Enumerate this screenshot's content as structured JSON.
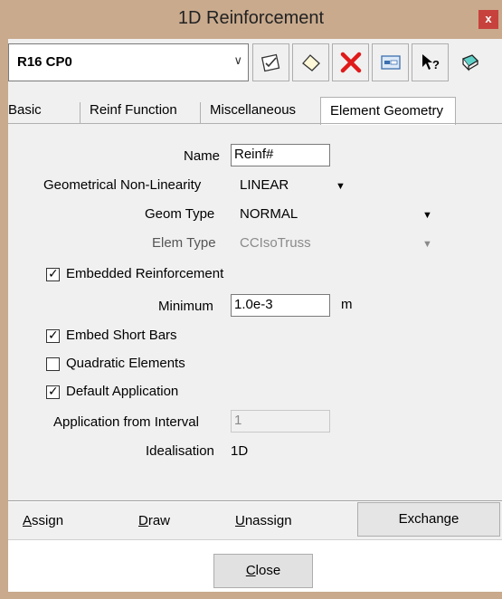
{
  "window": {
    "title": "1D Reinforcement",
    "close_glyph": "x"
  },
  "toolbar": {
    "selector_value": "R16 CP0",
    "buttons": [
      {
        "icon": "edit-check-icon"
      },
      {
        "icon": "eraser-icon"
      },
      {
        "icon": "delete-icon"
      },
      {
        "icon": "form-view-icon"
      },
      {
        "icon": "whats-this-help-icon"
      },
      {
        "icon": "sticky-note-icon"
      }
    ]
  },
  "tabs": [
    {
      "label": "Basic"
    },
    {
      "label": "Reinf Function"
    },
    {
      "label": "Miscellaneous"
    },
    {
      "label": "Element Geometry",
      "active": true
    }
  ],
  "form": {
    "name_label": "Name",
    "name_value": "Reinf#",
    "geom_nonlin_label": "Geometrical Non-Linearity",
    "geom_nonlin_value": "LINEAR",
    "geom_type_label": "Geom Type",
    "geom_type_value": "NORMAL",
    "elem_type_label": "Elem Type",
    "elem_type_value": "CCIsoTruss",
    "embedded_label": "Embedded Reinforcement",
    "minimum_label": "Minimum",
    "minimum_value": "1.0e-3",
    "minimum_unit": "m",
    "embed_short_label": "Embed Short Bars",
    "quadratic_label": "Quadratic Elements",
    "default_app_label": "Default Application",
    "app_interval_label": "Application from Interval",
    "app_interval_value": "1",
    "idealisation_label": "Idealisation",
    "idealisation_value": "1D",
    "checked": {
      "embedded": true,
      "embed_short": true,
      "quadratic": false,
      "default_app": true
    }
  },
  "actions": {
    "assign_prefix": "A",
    "assign_rest": "ssign",
    "draw_prefix": "D",
    "draw_rest": "raw",
    "unassign_prefix": "U",
    "unassign_rest": "nassign",
    "exchange": "Exchange",
    "close_prefix": "C",
    "close_rest": "lose"
  },
  "colors": {
    "title_bar": "#c9aa8d",
    "close_button": "#c7423c",
    "delete_red": "#e01a1a"
  }
}
